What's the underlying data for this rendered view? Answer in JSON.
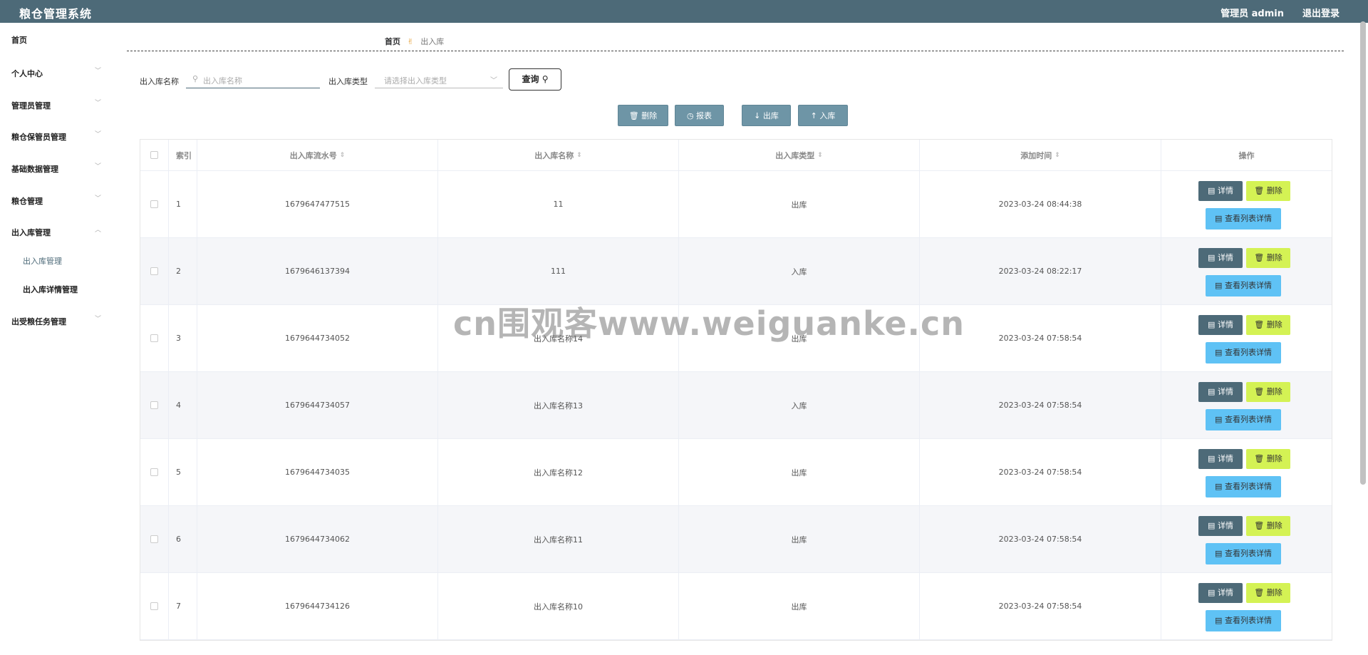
{
  "app": {
    "title": "粮仓管理系统",
    "user": "管理员 admin",
    "logout": "退出登录"
  },
  "sidebar": {
    "items": [
      {
        "label": "首页"
      },
      {
        "label": "个人中心"
      },
      {
        "label": "管理员管理"
      },
      {
        "label": "粮仓保管员管理"
      },
      {
        "label": "基础数据管理"
      },
      {
        "label": "粮仓管理"
      },
      {
        "label": "出入库管理"
      },
      {
        "label": "出受粮任务管理"
      }
    ],
    "subitems": [
      {
        "label": "出入库管理"
      },
      {
        "label": "出入库详情管理"
      }
    ],
    "chevron_down": "﹀",
    "chevron_up": "︿"
  },
  "breadcrumb": {
    "home": "首页",
    "separator_icon": "hand-icon",
    "current": "出入库"
  },
  "search": {
    "name_label": "出入库名称",
    "name_placeholder": "出入库名称",
    "type_label": "出入库类型",
    "type_placeholder": "请选择出入库类型",
    "query_label": "查询"
  },
  "actions": {
    "delete": "删除",
    "report": "报表",
    "out": "出库",
    "in": "入库"
  },
  "table": {
    "headers": {
      "index": "索引",
      "serial": "出入库流水号",
      "name": "出入库名称",
      "type": "出入库类型",
      "time": "添加时间",
      "ops": "操作"
    },
    "buttons": {
      "detail": "详情",
      "delete": "删除",
      "list": "查看列表详情"
    },
    "rows": [
      {
        "index": "1",
        "serial": "1679647477515",
        "name": "11",
        "type": "出库",
        "time": "2023-03-24 08:44:38"
      },
      {
        "index": "2",
        "serial": "1679646137394",
        "name": "111",
        "type": "入库",
        "time": "2023-03-24 08:22:17"
      },
      {
        "index": "3",
        "serial": "1679644734052",
        "name": "出入库名称14",
        "type": "出库",
        "time": "2023-03-24 07:58:54"
      },
      {
        "index": "4",
        "serial": "1679644734057",
        "name": "出入库名称13",
        "type": "入库",
        "time": "2023-03-24 07:58:54"
      },
      {
        "index": "5",
        "serial": "1679644734035",
        "name": "出入库名称12",
        "type": "出库",
        "time": "2023-03-24 07:58:54"
      },
      {
        "index": "6",
        "serial": "1679644734062",
        "name": "出入库名称11",
        "type": "出库",
        "time": "2023-03-24 07:58:54"
      },
      {
        "index": "7",
        "serial": "1679644734126",
        "name": "出入库名称10",
        "type": "出库",
        "time": "2023-03-24 07:58:54"
      }
    ]
  },
  "watermark": "cn围观客www.weiguanke.cn",
  "colors": {
    "header": "#4d6a78",
    "action_button": "#6e95a6",
    "delete_button": "#d4f254",
    "list_button": "#5fc2f5"
  }
}
